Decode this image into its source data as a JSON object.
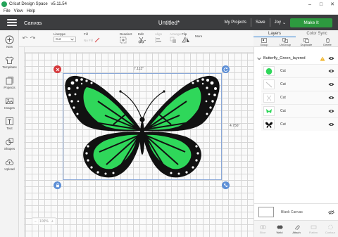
{
  "window": {
    "app_title": "Cricut Design Space",
    "version": "v5.11.54",
    "minimize": "–",
    "maximize": "□",
    "close": "✕"
  },
  "menubar": [
    "File",
    "View",
    "Help"
  ],
  "header": {
    "section": "Canvas",
    "document_title": "Untitled*",
    "my_projects": "My Projects",
    "save": "Save",
    "user": "Joy",
    "user_caret": "⌄",
    "make_it": "Make It",
    "make_it_color": "#2d9a3f"
  },
  "toolbar": {
    "linetype_label": "Linetype",
    "linetype_value": "Cut",
    "fill_label": "Fill",
    "fill_value": "No Fill",
    "deselect_label": "Deselect",
    "edit_label": "Edit",
    "align_label": "Align",
    "arrange_label": "Arrange",
    "flip_label": "Flip",
    "more_label": "More"
  },
  "layers_panel": {
    "tabs": [
      "Layers",
      "Color Sync"
    ],
    "actions": [
      "Group",
      "UnGroup",
      "Duplicate",
      "Delete"
    ],
    "group_name": "Butterfly_Green_layered",
    "layers": [
      {
        "name": "Cut",
        "thumb_color": "#2fd75a"
      },
      {
        "name": "Cut",
        "thumb_color": "#bbbbbb"
      },
      {
        "name": "Cut",
        "thumb_color": "#bbbbbb"
      },
      {
        "name": "Cut",
        "thumb_color": "#2fd75a"
      },
      {
        "name": "Cut",
        "thumb_color": "#111111"
      }
    ],
    "blank_canvas": "Blank Canvas",
    "bottom_actions": [
      "Slice",
      "Weld",
      "Attach",
      "Flatten",
      "Contour"
    ]
  },
  "sidebar": [
    {
      "label": "New",
      "icon": "plus-icon"
    },
    {
      "label": "Templates",
      "icon": "tshirt-icon"
    },
    {
      "label": "Projects",
      "icon": "projects-icon"
    },
    {
      "label": "Images",
      "icon": "image-icon"
    },
    {
      "label": "Text",
      "icon": "text-icon"
    },
    {
      "label": "Shapes",
      "icon": "shapes-icon"
    },
    {
      "label": "Upload",
      "icon": "upload-icon"
    }
  ],
  "canvas": {
    "width_dimension": "7.113\"",
    "height_dimension": "4.756\"",
    "zoom": "100%",
    "zoom_out": "−",
    "zoom_in": "+",
    "wing_color": "#2fd75a",
    "outline_color": "#111111"
  }
}
